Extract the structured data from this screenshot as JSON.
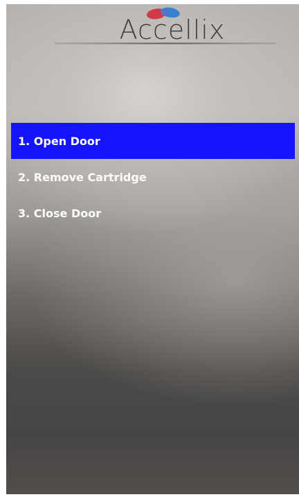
{
  "brand": {
    "name": "Accellix",
    "logo_icon": "two-overlapping-drops-logo",
    "colors": {
      "logo_red": "#d23a4c",
      "logo_blue": "#3a7fd6",
      "text": "#3f3f43"
    }
  },
  "menu": {
    "active_color": "#1414ff",
    "items": [
      {
        "label": "1. Open Door",
        "active": true
      },
      {
        "label": "2. Remove Cartridge",
        "active": false
      },
      {
        "label": "3. Close Door",
        "active": false
      }
    ]
  }
}
